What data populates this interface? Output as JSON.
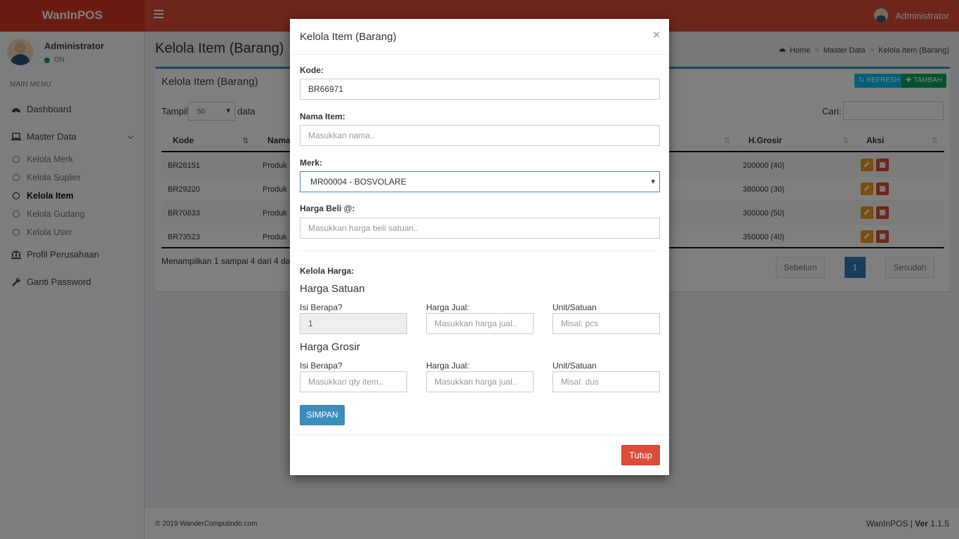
{
  "app": {
    "name": "WanInPOS"
  },
  "header": {
    "user": "Administrator"
  },
  "sidebar": {
    "user_name": "Administrator",
    "status": "ON",
    "menu_header": "MAIN MENU",
    "items": [
      {
        "label": "Dashboard",
        "icon": "dashboard-icon"
      },
      {
        "label": "Master Data",
        "icon": "laptop-icon"
      },
      {
        "label": "Profil Perusahaan",
        "icon": "bank-icon"
      },
      {
        "label": "Ganti Password",
        "icon": "wrench-icon"
      }
    ],
    "subitems": [
      {
        "label": "Kelola Merk"
      },
      {
        "label": "Kelola Suplier"
      },
      {
        "label": "Kelola Item"
      },
      {
        "label": "Kelola Gudang"
      },
      {
        "label": "Kelola User"
      }
    ]
  },
  "page": {
    "title": "Kelola Item (Barang)",
    "breadcrumb": [
      "Home",
      "Master Data",
      "Kelola Item (Barang)"
    ]
  },
  "box": {
    "title": "Kelola Item (Barang)",
    "refresh_label": "REFRESH",
    "tambah_label": "TAMBAH",
    "show_label": "Tampil",
    "show_value": "50",
    "data_label": "data",
    "search_label": "Cari:",
    "columns": [
      "Kode",
      "Nama",
      "H.Grosir",
      "Aksi"
    ],
    "rows": [
      {
        "kode": "BR26151",
        "nama": "Produk",
        "grosir": "200000 (40)"
      },
      {
        "kode": "BR29220",
        "nama": "Produk",
        "grosir": "380000 (30)"
      },
      {
        "kode": "BR70833",
        "nama": "Produk",
        "grosir": "300000 (50)"
      },
      {
        "kode": "BR73523",
        "nama": "Produk",
        "grosir": "350000 (40)"
      }
    ],
    "info": "Menampilkan 1 sampai 4 dari 4 data",
    "pagination": {
      "prev": "Sebelum",
      "current": "1",
      "next": "Sesudah"
    }
  },
  "footer": {
    "copyright": "© 2019  WanderComputindo.com",
    "app": "WanInPOS",
    "version_label": "Ver",
    "version": "1.1.5"
  },
  "modal": {
    "title": "Kelola Item (Barang)",
    "close": "×",
    "kode_label": "Kode:",
    "kode_value": "BR66971",
    "nama_label": "Nama Item:",
    "nama_placeholder": "Masukkan nama..",
    "merk_label": "Merk:",
    "merk_value": "MR00004 - BOSVOLARE",
    "harga_beli_label": "Harga Beli @:",
    "harga_beli_placeholder": "Masukkan harga beli satuan..",
    "kelola_harga_label": "Kelola Harga:",
    "satuan": {
      "title": "Harga Satuan",
      "isi_label": "Isi Berapa?",
      "isi_value": "1",
      "jual_label": "Harga Jual:",
      "jual_placeholder": "Masukkan harga jual..",
      "unit_label": "Unit/Satuan",
      "unit_placeholder": "Misal: pcs"
    },
    "grosir": {
      "title": "Harga Grosir",
      "isi_label": "Isi Berapa?",
      "isi_placeholder": "Masukkan qty item..",
      "jual_label": "Harga Jual:",
      "jual_placeholder": "Masukkan harga jual..",
      "unit_label": "Unit/Satuan",
      "unit_placeholder": "Misal: dus"
    },
    "simpan_label": "SIMPAN",
    "tutup_label": "Tutup"
  }
}
